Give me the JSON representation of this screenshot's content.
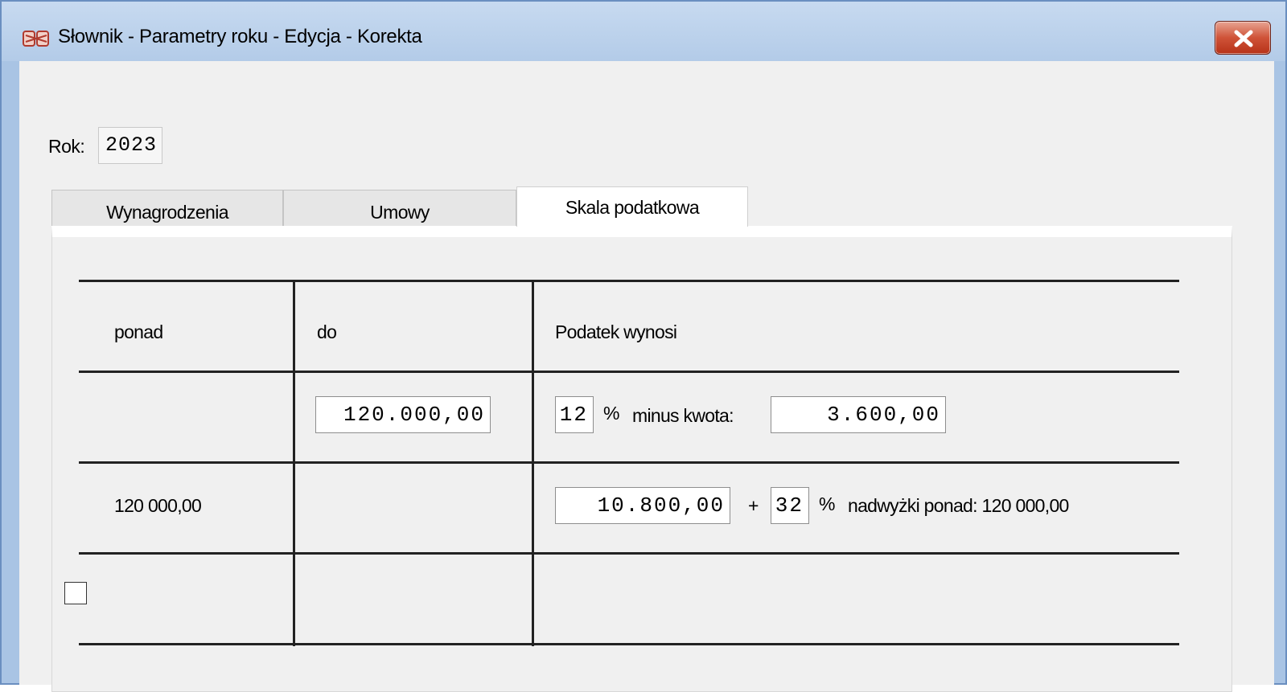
{
  "window": {
    "title": "Słownik - Parametry roku - Edycja - Korekta"
  },
  "year": {
    "label": "Rok:",
    "value": "2023"
  },
  "tabs": [
    {
      "label": "Wynagrodzenia",
      "active": false
    },
    {
      "label": "Umowy",
      "active": false
    },
    {
      "label": "Skala podatkowa",
      "active": true
    }
  ],
  "tax_table": {
    "headers": {
      "over": "ponad",
      "to": "do",
      "tax": "Podatek wynosi"
    },
    "row1": {
      "over": "",
      "to_value": "120.000,00",
      "rate_value": "12",
      "percent_sign": "%",
      "minus_label": "minus kwota:",
      "minus_value": "3.600,00"
    },
    "row2": {
      "over": "120 000,00",
      "base_value": "10.800,00",
      "plus_sign": "+",
      "rate_value": "32",
      "percent_sign": "%",
      "surplus_label": "nadwyżki ponad: 120 000,00"
    },
    "row3": {
      "checkbox_checked": false
    }
  },
  "colors": {
    "title_bar": "#b9cfea",
    "client_bg": "#f0f0f0",
    "close_button": "#cf5338"
  }
}
